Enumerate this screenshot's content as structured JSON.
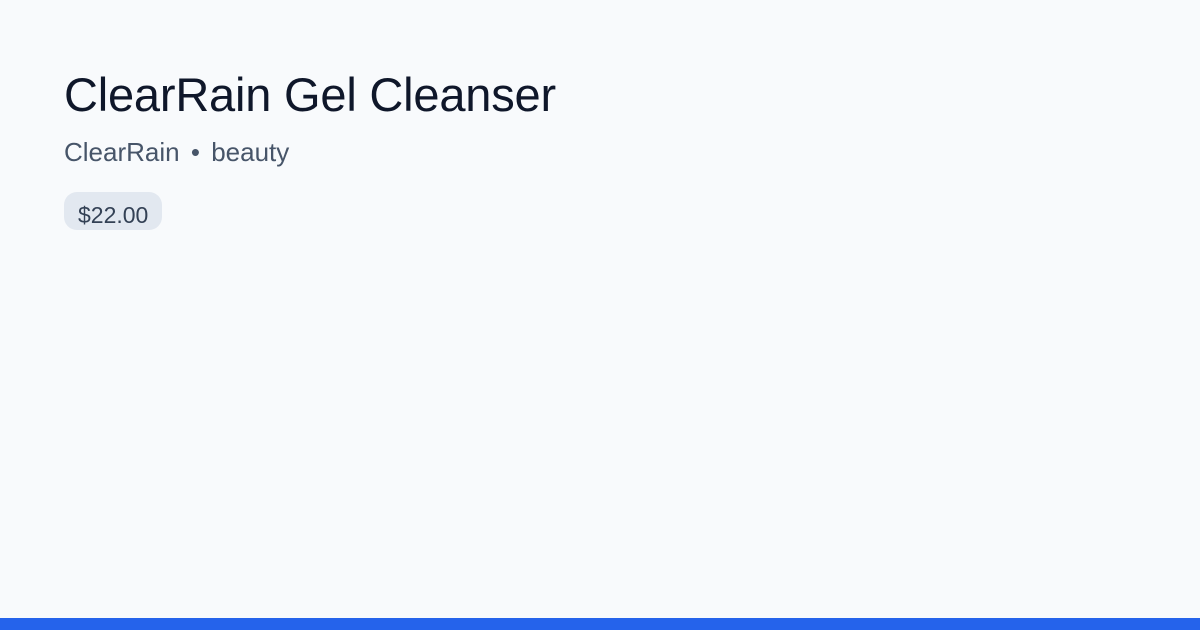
{
  "product": {
    "title": "ClearRain Gel Cleanser",
    "brand": "ClearRain",
    "separator": "•",
    "category": "beauty",
    "price": "$22.00"
  },
  "colors": {
    "background": "#f8fafc",
    "accent": "#2563eb",
    "badge_bg": "#e2e8f0"
  }
}
